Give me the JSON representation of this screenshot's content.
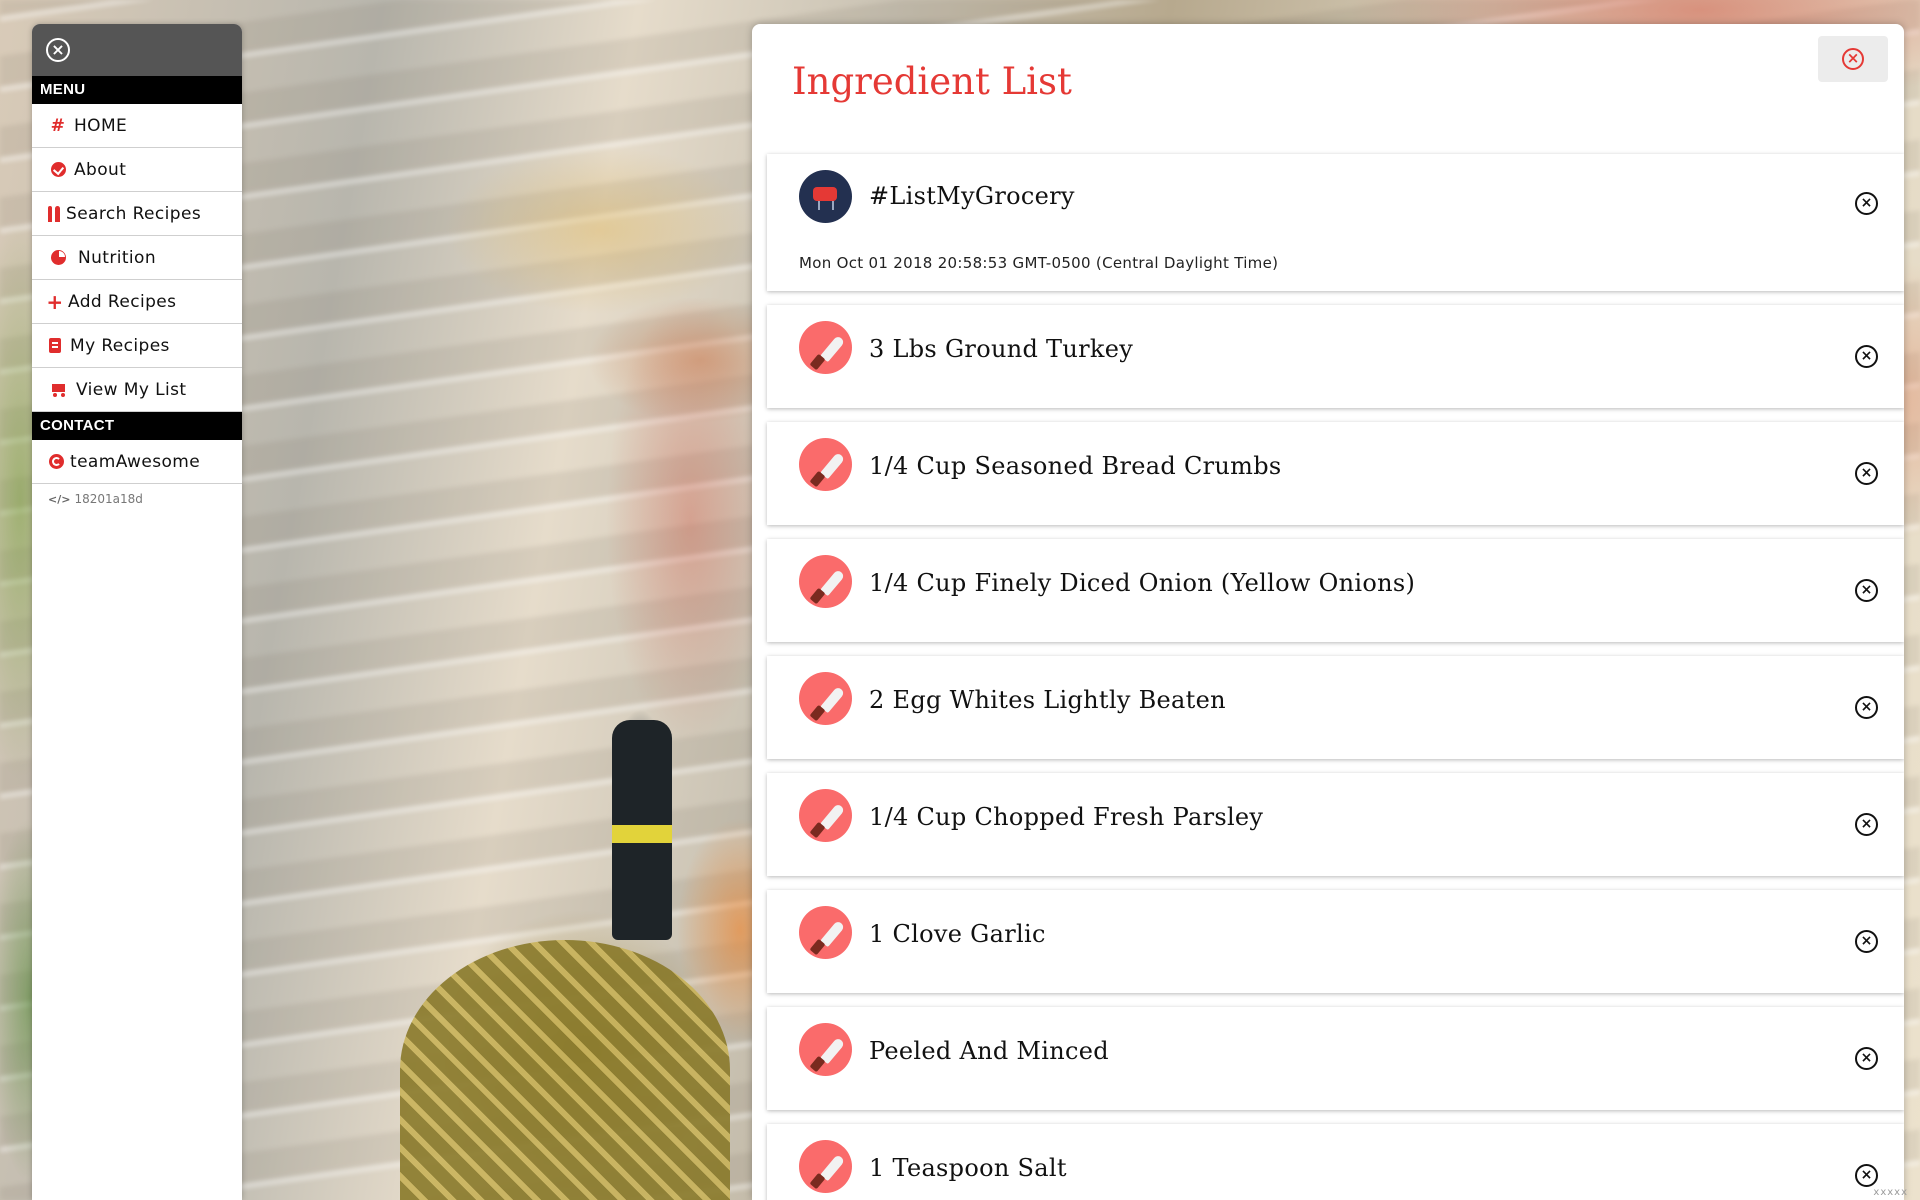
{
  "sidebar": {
    "menu_heading": "MENU",
    "items": [
      {
        "label": "HOME",
        "icon": "hash-icon"
      },
      {
        "label": "About",
        "icon": "check-circle-icon"
      },
      {
        "label": "Search Recipes",
        "icon": "utensils-icon"
      },
      {
        "label": "Nutrition",
        "icon": "pie-chart-icon"
      },
      {
        "label": "Add Recipes",
        "icon": "plus-icon"
      },
      {
        "label": "My Recipes",
        "icon": "book-icon"
      },
      {
        "label": "View My List",
        "icon": "cart-icon"
      }
    ],
    "contact_heading": "CONTACT",
    "contact_item": {
      "label": "teamAwesome",
      "icon": "copyright-icon"
    },
    "version": "18201a18d"
  },
  "panel": {
    "title": "Ingredient List",
    "header_card": {
      "title": "#ListMyGrocery",
      "date": "Mon Oct 01 2018 20:58:53 GMT-0500 (Central Daylight Time)"
    },
    "ingredients": [
      "3 Lbs Ground Turkey",
      "1/4 Cup Seasoned Bread Crumbs",
      "1/4 Cup Finely Diced Onion (Yellow Onions)",
      "2 Egg Whites Lightly Beaten",
      "1/4 Cup Chopped Fresh Parsley",
      "1 Clove Garlic",
      "Peeled And Minced",
      "1 Teaspoon Salt"
    ]
  },
  "watermark": "xxxxx",
  "colors": {
    "accent": "#e53935",
    "menu_section_bg": "#000000",
    "sidebar_top_bg": "#555555"
  }
}
